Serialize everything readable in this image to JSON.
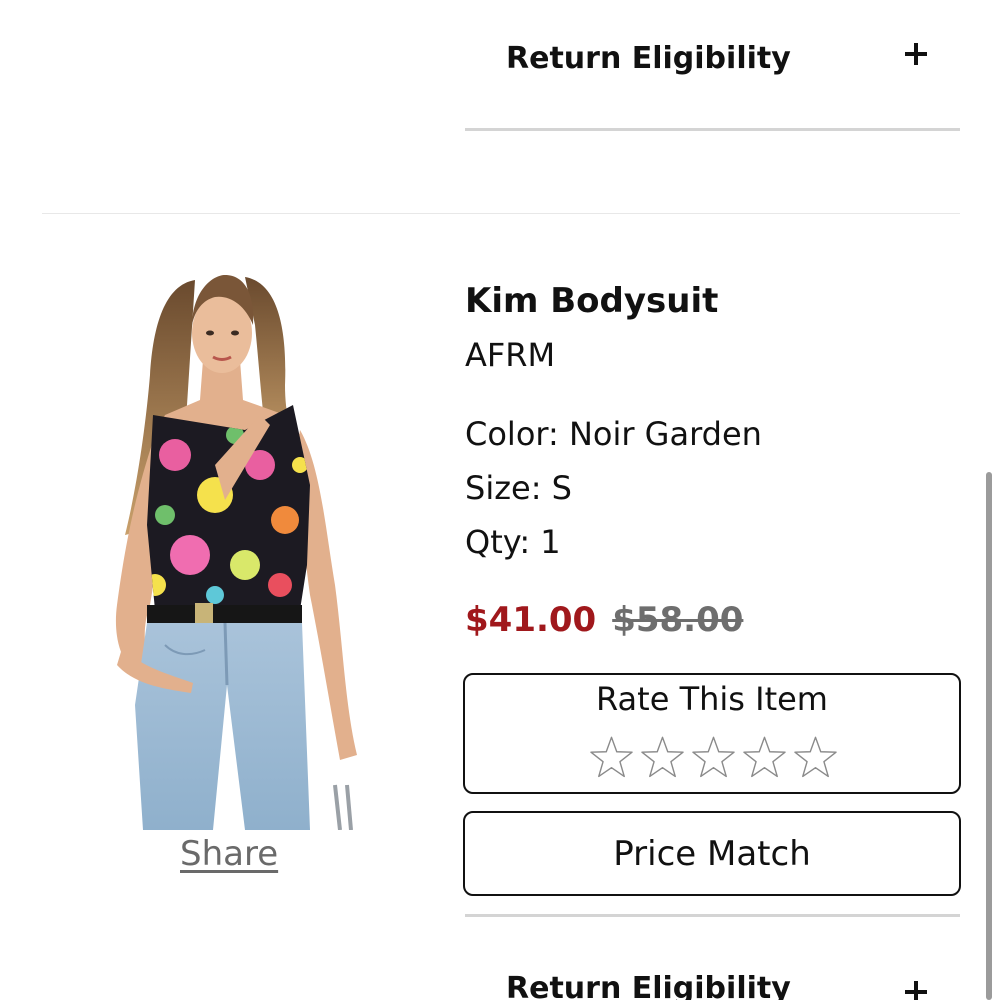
{
  "accordion": {
    "return_eligibility_label": "Return Eligibility",
    "expand_symbol": "+"
  },
  "product": {
    "name": "Kim Bodysuit",
    "brand": "AFRM",
    "color_line": "Color: Noir Garden",
    "size_line": "Size: S",
    "qty_line": "Qty: 1",
    "sale_price": "$41.00",
    "original_price": "$58.00",
    "image_alt": "Model wearing one-shoulder floral bodysuit with light wash jeans",
    "colors": {
      "sale_price": "#a0181c",
      "original_price": "#6e6e6e"
    }
  },
  "rating": {
    "title": "Rate This Item",
    "max_stars": 5,
    "selected_stars": 0
  },
  "actions": {
    "share_label": "Share",
    "price_match_label": "Price Match"
  },
  "next_item": {
    "accordion_label": "Return Eligibility"
  }
}
